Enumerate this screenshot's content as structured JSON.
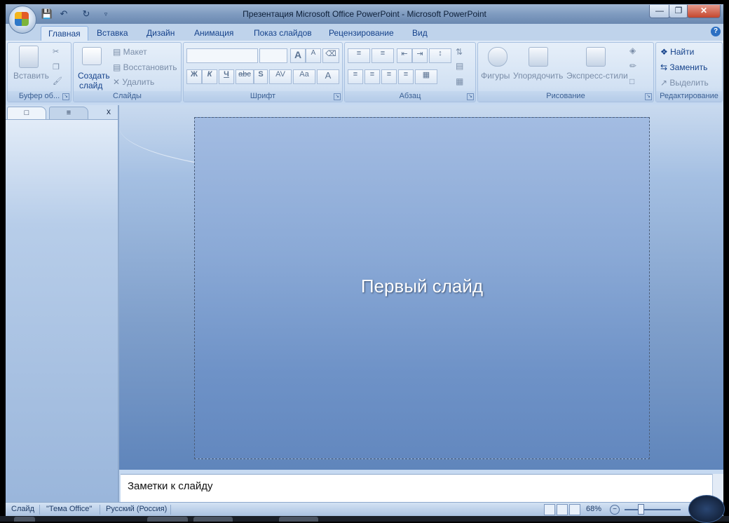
{
  "titlebar": {
    "title": "Презентация Microsoft Office PowerPoint - Microsoft PowerPoint",
    "qat_icons": [
      "save-icon",
      "undo-icon",
      "redo-icon",
      "customize-icon"
    ],
    "minimize": "—",
    "maximize": "❐",
    "close": "✕"
  },
  "tabs": [
    "Главная",
    "Вставка",
    "Дизайн",
    "Анимация",
    "Показ слайдов",
    "Рецензирование",
    "Вид"
  ],
  "help": "?",
  "ribbon": {
    "clipboard": {
      "paste": "Вставить",
      "label": "Буфер об..."
    },
    "slides": {
      "new_slide_1": "Создать",
      "new_slide_2": "слайд",
      "layout": "Макет",
      "reset": "Восстановить",
      "delete": "Удалить",
      "label": "Слайды"
    },
    "font": {
      "bold": "Ж",
      "italic": "К",
      "underline": "Ч",
      "strike": "abc",
      "shadow": "S",
      "spacing": "AV",
      "case": "Aa",
      "color": "A",
      "grow": "A",
      "shrink": "A",
      "label": "Шрифт"
    },
    "paragraph": {
      "label": "Абзац"
    },
    "drawing": {
      "shapes": "Фигуры",
      "arrange": "Упорядочить",
      "styles": "Экспресс-стили",
      "label": "Рисование"
    },
    "editing": {
      "find": "Найти",
      "replace": "Заменить",
      "select": "Выделить",
      "label": "Редактирование"
    }
  },
  "left_panel": {
    "close": "x"
  },
  "slide": {
    "title": "Первый слайд"
  },
  "notes": {
    "placeholder": "Заметки к слайду"
  },
  "status": {
    "slide": "Слайд",
    "theme": "\"Тема Office\"",
    "language": "Русский (Россия)",
    "zoom": "68%",
    "zoom_value": 0.68
  }
}
